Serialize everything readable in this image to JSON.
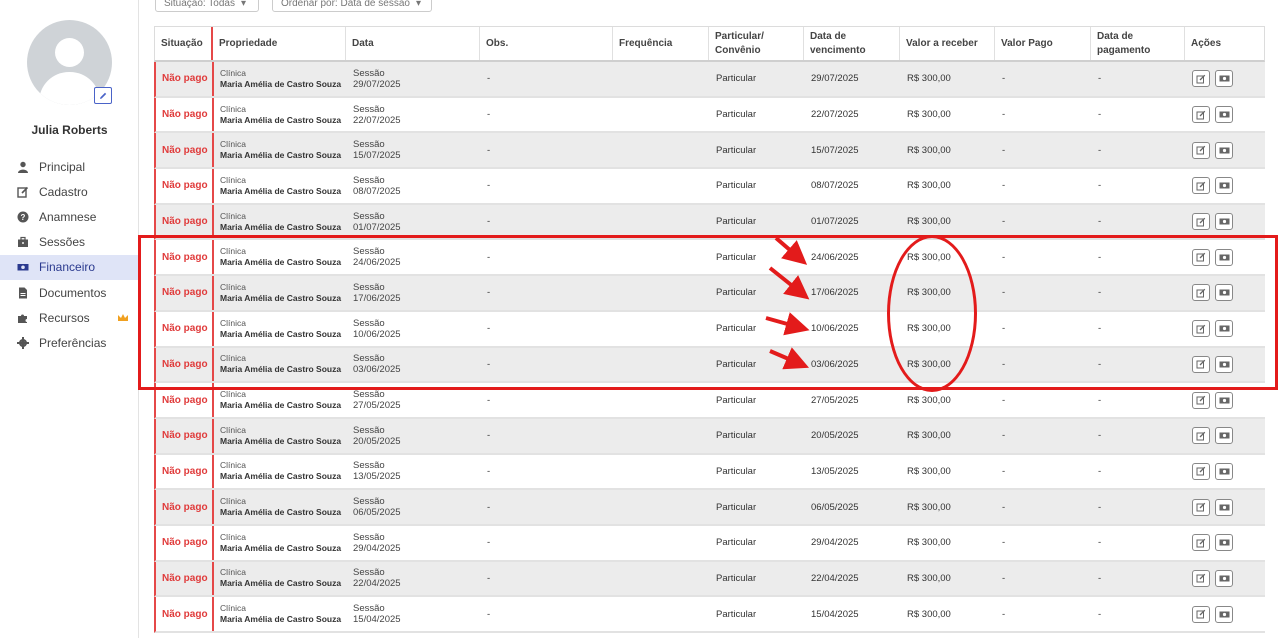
{
  "sidebar": {
    "user_name": "Julia Roberts",
    "items": [
      {
        "label": "Principal",
        "icon": "user-icon"
      },
      {
        "label": "Cadastro",
        "icon": "edit-icon"
      },
      {
        "label": "Anamnese",
        "icon": "question-icon"
      },
      {
        "label": "Sessões",
        "icon": "briefcase-icon"
      },
      {
        "label": "Financeiro",
        "icon": "money-icon",
        "active": true
      },
      {
        "label": "Documentos",
        "icon": "document-icon"
      },
      {
        "label": "Recursos",
        "icon": "puzzle-icon",
        "badge_icon": "crown-icon"
      },
      {
        "label": "Preferências",
        "icon": "gear-icon"
      }
    ]
  },
  "filters": {
    "situacao": "Situação: Todas",
    "ordenar": "Ordenar por: Data de sessão"
  },
  "table": {
    "headers": [
      "Situação",
      "Propriedade",
      "Data",
      "Obs.",
      "Frequência",
      "Particular/\nConvênio",
      "Data de vencimento",
      "Valor a receber",
      "Valor Pago",
      "Data de pagamento",
      "Ações"
    ],
    "rows": [
      {
        "situacao": "Não pago",
        "prop_top": "Clínica",
        "prop_bot": "Maria Amélia de Castro Souza",
        "data_top": "Sessão",
        "data_bot": "29/07/2025",
        "obs": "-",
        "freq": "",
        "part": "Particular",
        "venc": "29/07/2025",
        "valor": "R$ 300,00",
        "pago": "-",
        "dpag": "-"
      },
      {
        "situacao": "Não pago",
        "prop_top": "Clínica",
        "prop_bot": "Maria Amélia de Castro Souza",
        "data_top": "Sessão",
        "data_bot": "22/07/2025",
        "obs": "-",
        "freq": "",
        "part": "Particular",
        "venc": "22/07/2025",
        "valor": "R$ 300,00",
        "pago": "-",
        "dpag": "-"
      },
      {
        "situacao": "Não pago",
        "prop_top": "Clínica",
        "prop_bot": "Maria Amélia de Castro Souza",
        "data_top": "Sessão",
        "data_bot": "15/07/2025",
        "obs": "-",
        "freq": "",
        "part": "Particular",
        "venc": "15/07/2025",
        "valor": "R$ 300,00",
        "pago": "-",
        "dpag": "-"
      },
      {
        "situacao": "Não pago",
        "prop_top": "Clínica",
        "prop_bot": "Maria Amélia de Castro Souza",
        "data_top": "Sessão",
        "data_bot": "08/07/2025",
        "obs": "-",
        "freq": "",
        "part": "Particular",
        "venc": "08/07/2025",
        "valor": "R$ 300,00",
        "pago": "-",
        "dpag": "-"
      },
      {
        "situacao": "Não pago",
        "prop_top": "Clínica",
        "prop_bot": "Maria Amélia de Castro Souza",
        "data_top": "Sessão",
        "data_bot": "01/07/2025",
        "obs": "-",
        "freq": "",
        "part": "Particular",
        "venc": "01/07/2025",
        "valor": "R$ 300,00",
        "pago": "-",
        "dpag": "-"
      },
      {
        "situacao": "Não pago",
        "prop_top": "Clínica",
        "prop_bot": "Maria Amélia de Castro Souza",
        "data_top": "Sessão",
        "data_bot": "24/06/2025",
        "obs": "-",
        "freq": "",
        "part": "Particular",
        "venc": "24/06/2025",
        "valor": "R$ 300,00",
        "pago": "-",
        "dpag": "-"
      },
      {
        "situacao": "Não pago",
        "prop_top": "Clínica",
        "prop_bot": "Maria Amélia de Castro Souza",
        "data_top": "Sessão",
        "data_bot": "17/06/2025",
        "obs": "-",
        "freq": "",
        "part": "Particular",
        "venc": "17/06/2025",
        "valor": "R$ 300,00",
        "pago": "-",
        "dpag": "-"
      },
      {
        "situacao": "Não pago",
        "prop_top": "Clínica",
        "prop_bot": "Maria Amélia de Castro Souza",
        "data_top": "Sessão",
        "data_bot": "10/06/2025",
        "obs": "-",
        "freq": "",
        "part": "Particular",
        "venc": "10/06/2025",
        "valor": "R$ 300,00",
        "pago": "-",
        "dpag": "-"
      },
      {
        "situacao": "Não pago",
        "prop_top": "Clínica",
        "prop_bot": "Maria Amélia de Castro Souza",
        "data_top": "Sessão",
        "data_bot": "03/06/2025",
        "obs": "-",
        "freq": "",
        "part": "Particular",
        "venc": "03/06/2025",
        "valor": "R$ 300,00",
        "pago": "-",
        "dpag": "-"
      },
      {
        "situacao": "Não pago",
        "prop_top": "Clínica",
        "prop_bot": "Maria Amélia de Castro Souza",
        "data_top": "Sessão",
        "data_bot": "27/05/2025",
        "obs": "-",
        "freq": "",
        "part": "Particular",
        "venc": "27/05/2025",
        "valor": "R$ 300,00",
        "pago": "-",
        "dpag": "-"
      },
      {
        "situacao": "Não pago",
        "prop_top": "Clínica",
        "prop_bot": "Maria Amélia de Castro Souza",
        "data_top": "Sessão",
        "data_bot": "20/05/2025",
        "obs": "-",
        "freq": "",
        "part": "Particular",
        "venc": "20/05/2025",
        "valor": "R$ 300,00",
        "pago": "-",
        "dpag": "-"
      },
      {
        "situacao": "Não pago",
        "prop_top": "Clínica",
        "prop_bot": "Maria Amélia de Castro Souza",
        "data_top": "Sessão",
        "data_bot": "13/05/2025",
        "obs": "-",
        "freq": "",
        "part": "Particular",
        "venc": "13/05/2025",
        "valor": "R$ 300,00",
        "pago": "-",
        "dpag": "-"
      },
      {
        "situacao": "Não pago",
        "prop_top": "Clínica",
        "prop_bot": "Maria Amélia de Castro Souza",
        "data_top": "Sessão",
        "data_bot": "06/05/2025",
        "obs": "-",
        "freq": "",
        "part": "Particular",
        "venc": "06/05/2025",
        "valor": "R$ 300,00",
        "pago": "-",
        "dpag": "-"
      },
      {
        "situacao": "Não pago",
        "prop_top": "Clínica",
        "prop_bot": "Maria Amélia de Castro Souza",
        "data_top": "Sessão",
        "data_bot": "29/04/2025",
        "obs": "-",
        "freq": "",
        "part": "Particular",
        "venc": "29/04/2025",
        "valor": "R$ 300,00",
        "pago": "-",
        "dpag": "-"
      },
      {
        "situacao": "Não pago",
        "prop_top": "Clínica",
        "prop_bot": "Maria Amélia de Castro Souza",
        "data_top": "Sessão",
        "data_bot": "22/04/2025",
        "obs": "-",
        "freq": "",
        "part": "Particular",
        "venc": "22/04/2025",
        "valor": "R$ 300,00",
        "pago": "-",
        "dpag": "-"
      },
      {
        "situacao": "Não pago",
        "prop_top": "Clínica",
        "prop_bot": "Maria Amélia de Castro Souza",
        "data_top": "Sessão",
        "data_bot": "15/04/2025",
        "obs": "-",
        "freq": "",
        "part": "Particular",
        "venc": "15/04/2025",
        "valor": "R$ 300,00",
        "pago": "-",
        "dpag": "-"
      }
    ]
  },
  "colors": {
    "status_red": "#e03b3b",
    "annotation_red": "#e31b1b",
    "active_menu_bg": "#dfe4f7",
    "row_alt_bg": "#ececec"
  }
}
